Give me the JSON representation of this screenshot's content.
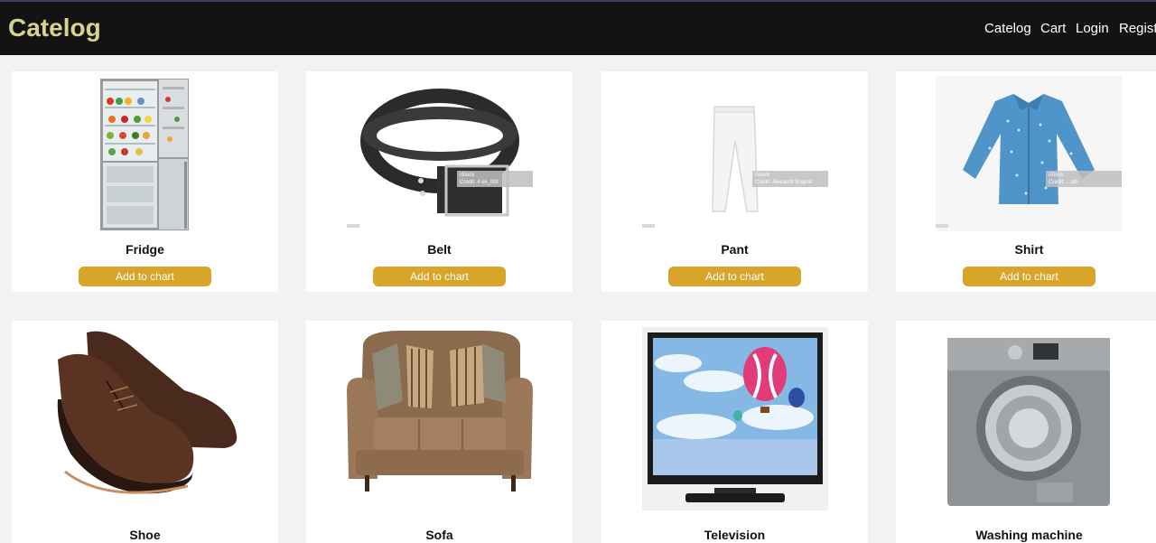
{
  "brand": "Catelog",
  "nav": {
    "catelog": "Catelog",
    "cart": "Cart",
    "login": "Login",
    "register": "Register"
  },
  "products": [
    {
      "name": "Fridge",
      "button": "Add to chart",
      "icon": "fridge-image"
    },
    {
      "name": "Belt",
      "button": "Add to chart",
      "icon": "belt-image"
    },
    {
      "name": "Pant",
      "button": "Add to chart",
      "icon": "pant-image"
    },
    {
      "name": "Shirt",
      "button": "Add to chart",
      "icon": "shirt-image"
    },
    {
      "name": "Shoe",
      "icon": "shoe-image"
    },
    {
      "name": "Sofa",
      "icon": "sofa-image"
    },
    {
      "name": "Television",
      "icon": "television-image"
    },
    {
      "name": "Washing machine",
      "icon": "washing-machine-image"
    }
  ],
  "watermarks": {
    "belt": {
      "brand": "iStock",
      "credit": "Credit: 4 ex_MX"
    },
    "pant": {
      "brand": "iStock",
      "credit": "Credit: Alexandr Bognat"
    },
    "shirt": {
      "brand": "iStock",
      "credit": "Credit: ...ath"
    }
  },
  "colors": {
    "navbar": "#131313",
    "brand": "#d6d48a",
    "button": "#d9a42a",
    "page_bg": "#f3f1f2"
  }
}
